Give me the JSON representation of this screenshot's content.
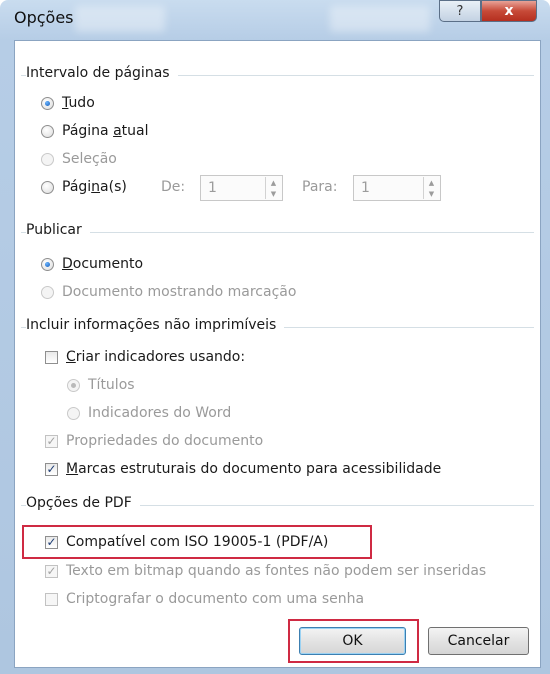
{
  "window": {
    "title": "Opções",
    "help_label": "?",
    "close_label": "x"
  },
  "page_range": {
    "title": "Intervalo de páginas",
    "all": {
      "pre": "",
      "key": "T",
      "post": "udo"
    },
    "current": {
      "pre": "Página ",
      "key": "a",
      "post": "tual"
    },
    "selection": "Seleção",
    "pages": {
      "pre": "Pági",
      "key": "n",
      "post": "a(s)"
    },
    "from_label": "De:",
    "from_value": "1",
    "to_label": "Para:",
    "to_value": "1"
  },
  "publish": {
    "title": "Publicar",
    "document": {
      "pre": "",
      "key": "D",
      "post": "ocumento"
    },
    "document_markup": "Documento mostrando marcação"
  },
  "nonprint": {
    "title": "Incluir informações não imprimíveis",
    "bookmarks": {
      "pre": "",
      "key": "C",
      "post": "riar indicadores usando:"
    },
    "headings": "Títulos",
    "word_bookmarks": "Indicadores do Word",
    "doc_properties": "Propriedades do documento",
    "structure_tags": {
      "pre": "",
      "key": "M",
      "post": "arcas estruturais do documento para acessibilidade"
    }
  },
  "pdf": {
    "title": "Opções de PDF",
    "iso": "Compatível com ISO 19005-1 (PDF/A)",
    "bitmap": "Texto em bitmap quando as fontes não podem ser inseridas",
    "encrypt": "Criptografar o documento com uma senha"
  },
  "buttons": {
    "ok": "OK",
    "cancel": "Cancelar"
  },
  "colors": {
    "highlight": "#cf2a43",
    "close_button": "#c74a38",
    "radio_checked": "#1258b6"
  },
  "state": {
    "page_range_selected": "all",
    "publish_selected": "document",
    "create_bookmarks": false,
    "bookmarks_using": "headings",
    "doc_properties": true,
    "structure_tags": true,
    "iso_pdfa": true,
    "bitmap_text": true,
    "encrypt": false
  }
}
